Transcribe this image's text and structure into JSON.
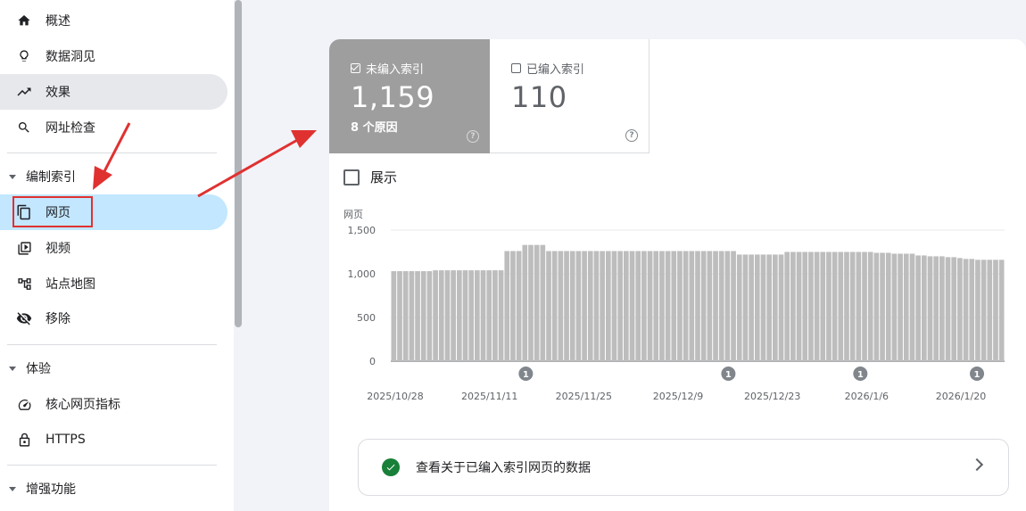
{
  "sidebar": {
    "top_items": [
      {
        "label": "概述",
        "icon": "home-icon"
      },
      {
        "label": "数据洞见",
        "icon": "lightbulb-icon"
      },
      {
        "label": "效果",
        "icon": "trending-up-icon"
      },
      {
        "label": "网址检查",
        "icon": "search-icon"
      }
    ],
    "section_index": {
      "title": "编制索引",
      "items": [
        {
          "label": "网页",
          "icon": "pages-icon"
        },
        {
          "label": "视频",
          "icon": "video-icon"
        },
        {
          "label": "站点地图",
          "icon": "sitemap-icon"
        },
        {
          "label": "移除",
          "icon": "visibility-off-icon"
        }
      ]
    },
    "section_experience": {
      "title": "体验",
      "items": [
        {
          "label": "核心网页指标",
          "icon": "speed-icon"
        },
        {
          "label": "HTTPS",
          "icon": "lock-icon"
        }
      ]
    },
    "section_enhancements": {
      "title": "增强功能"
    }
  },
  "cards": {
    "unindexed": {
      "label": "未编入索引",
      "value": "1,159",
      "sub": "8 个原因",
      "checked": true
    },
    "indexed": {
      "label": "已编入索引",
      "value": "110",
      "checked": false
    }
  },
  "show_toggle": {
    "label": "展示"
  },
  "info_card": {
    "text": "查看关于已编入索引网页的数据"
  },
  "colors": {
    "accent": "#c2e7ff",
    "bar": "#bdbdbd",
    "unindexed_card": "#9e9e9e",
    "success": "#188038",
    "annotation": "#e03131"
  },
  "chart_data": {
    "type": "bar",
    "ylabel": "网页",
    "ylim": [
      0,
      1500
    ],
    "yticks": [
      "0",
      "500",
      "1,000",
      "1,500"
    ],
    "xtick_labels": [
      "2025/10/28",
      "2025/11/11",
      "2025/11/25",
      "2025/12/9",
      "2025/12/23",
      "2026/1/6",
      "2026/1/20"
    ],
    "annotation_markers": [
      "1",
      "1",
      "1",
      "1"
    ],
    "values": [
      1030,
      1030,
      1030,
      1030,
      1030,
      1030,
      1030,
      1040,
      1040,
      1040,
      1040,
      1040,
      1040,
      1040,
      1040,
      1040,
      1040,
      1040,
      1040,
      1260,
      1260,
      1260,
      1330,
      1330,
      1330,
      1330,
      1260,
      1260,
      1260,
      1260,
      1260,
      1260,
      1260,
      1260,
      1260,
      1260,
      1260,
      1260,
      1260,
      1260,
      1260,
      1260,
      1260,
      1260,
      1260,
      1260,
      1260,
      1260,
      1260,
      1260,
      1260,
      1260,
      1260,
      1260,
      1260,
      1260,
      1260,
      1260,
      1220,
      1220,
      1220,
      1220,
      1220,
      1220,
      1220,
      1220,
      1250,
      1250,
      1250,
      1250,
      1250,
      1250,
      1250,
      1250,
      1250,
      1250,
      1250,
      1250,
      1250,
      1250,
      1250,
      1240,
      1240,
      1240,
      1230,
      1230,
      1230,
      1230,
      1210,
      1210,
      1200,
      1200,
      1200,
      1190,
      1190,
      1180,
      1170,
      1170,
      1160,
      1160,
      1160,
      1160,
      1160
    ]
  }
}
